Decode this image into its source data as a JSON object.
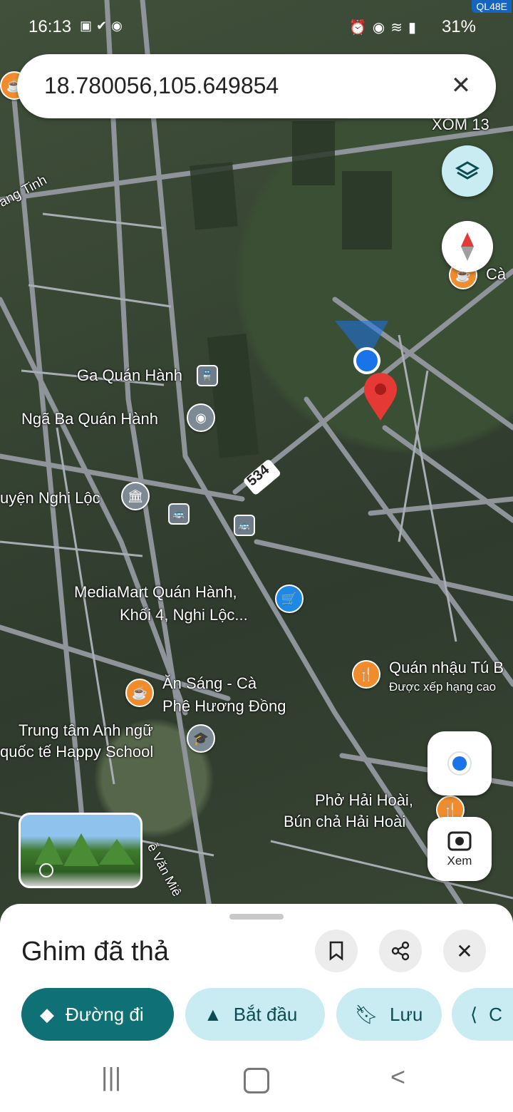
{
  "status_bar": {
    "time": "16:13",
    "battery": "31%",
    "carrier_badge": "QL48E"
  },
  "search": {
    "query": "18.780056,105.649854",
    "clear_icon": "close-icon"
  },
  "map": {
    "labels": {
      "xom13": "XÓM 13",
      "ca": "Cà",
      "ang_tinh": "ang Tinh",
      "ga_quan_hanh": "Ga Quán Hành",
      "nga_ba": "Ngã Ba Quán Hành",
      "uyen_nghi_loc": "uyện Nghi Lộc",
      "road_534": "534",
      "mediamart_1": "MediaMart Quán Hành,",
      "mediamart_2": "Khối 4, Nghi Lộc...",
      "quan_nhau": "Quán nhậu Tú B",
      "quan_nhau_sub": "Được xếp hạng cao",
      "an_sang_1": "Ăn Sáng - Cà",
      "an_sang_2": "Phê Hương Đồng",
      "trung_tam_1": "Trung tâm Anh ngữ",
      "trung_tam_2": "quốc tế Happy School",
      "pho_1": "Phở Hải Hoài,",
      "pho_2": "Bún chả Hải Hoài",
      "street_bottom": "ễ Văn Miê"
    }
  },
  "controls": {
    "layers_icon": "layers-icon",
    "compass_icon": "compass-icon",
    "my_location_icon": "my-location-icon",
    "lens_label": "Xem"
  },
  "sheet": {
    "title": "Ghim đã thả",
    "chips": {
      "directions": "Đường đi",
      "start": "Bắt đầu",
      "save": "Lưu",
      "share": "C"
    }
  },
  "colors": {
    "primary_chip": "#0f7075",
    "secondary_chip": "#c9ecf2",
    "pin_red": "#e53935",
    "location_blue": "#1a73e8"
  }
}
